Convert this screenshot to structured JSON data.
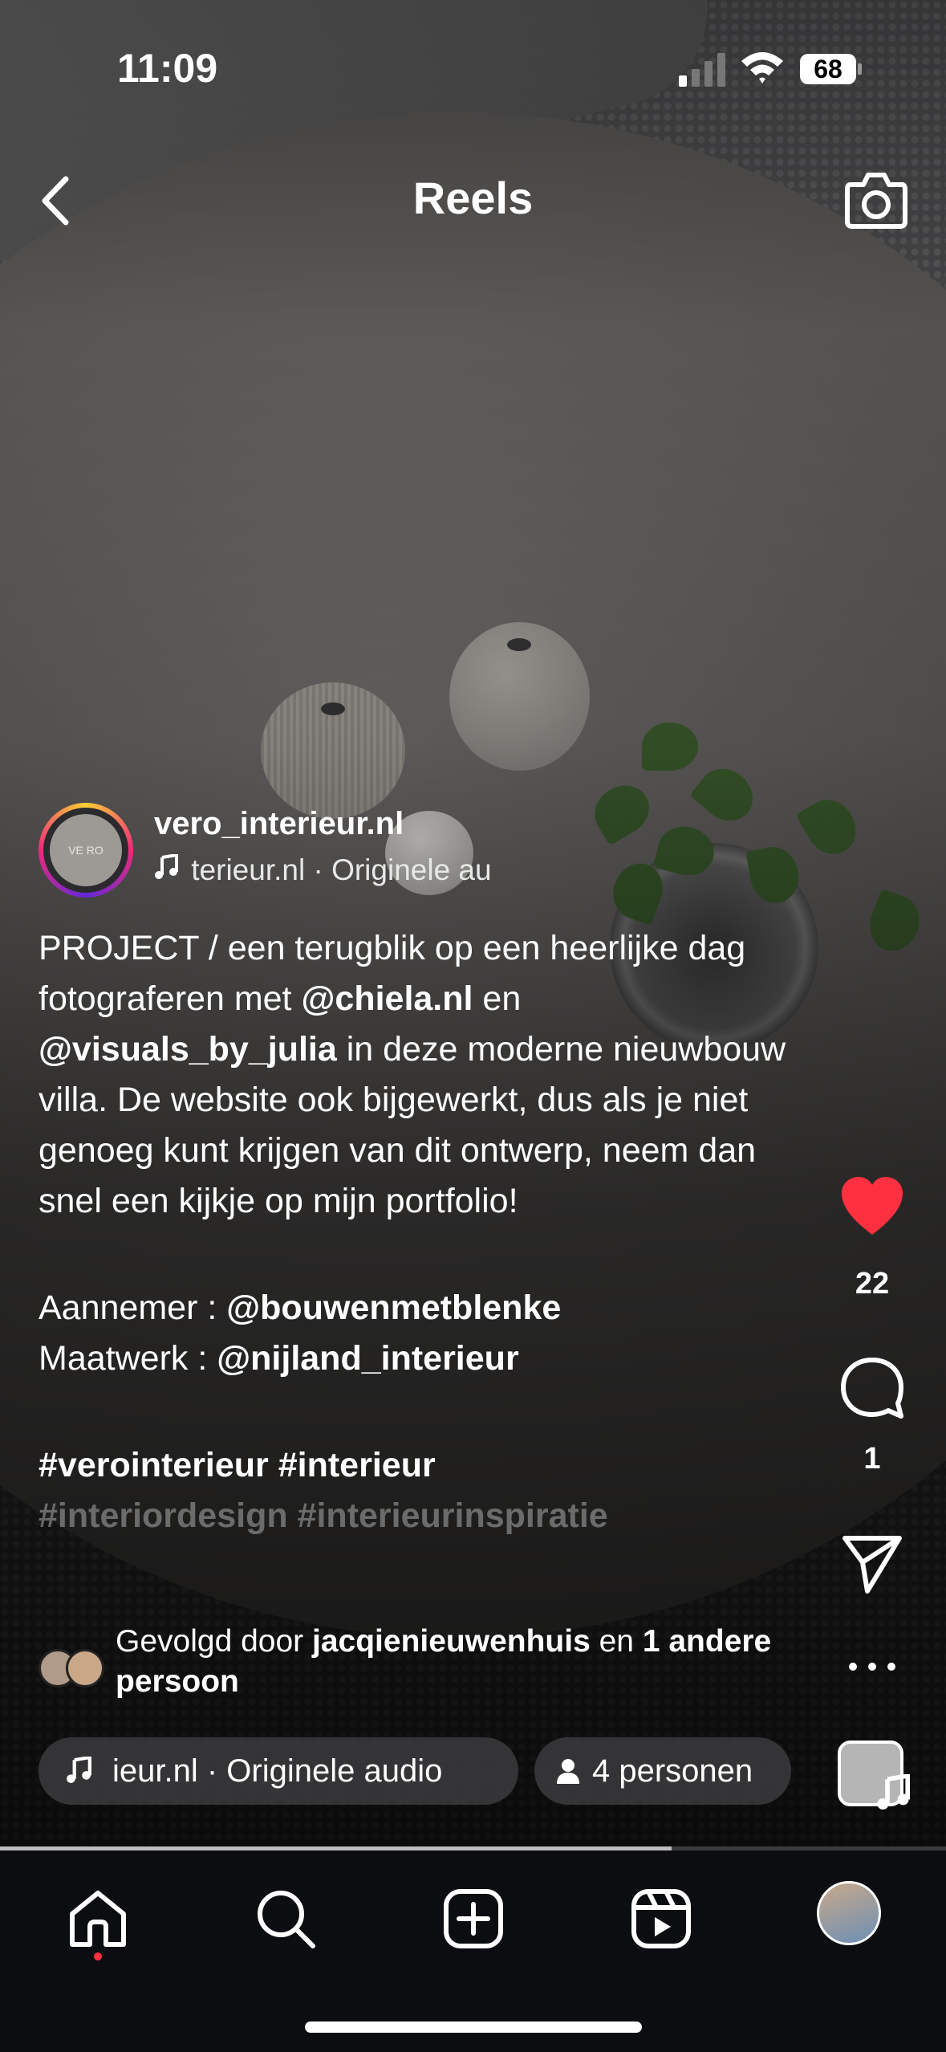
{
  "status": {
    "time": "11:09",
    "battery": "68"
  },
  "header": {
    "title": "Reels"
  },
  "post": {
    "username": "vero_interieur.nl",
    "avatar_text": "VE RO",
    "audio_line": "terieur.nl · Originele au",
    "caption": [
      [
        {
          "t": "PROJECT / een terugblik op een heerlijke dag fotograferen met "
        },
        {
          "t": "@chiela.nl",
          "b": true
        },
        {
          "t": " en "
        },
        {
          "t": "@visuals_by_julia",
          "b": true
        },
        {
          "t": " in deze moderne nieuwbouw villa. De website ook bijgewerkt, dus als je niet genoeg kunt krijgen van dit ontwerp, neem dan snel een kijkje op mijn portfolio!"
        }
      ],
      [
        {
          "t": "Aannemer : "
        },
        {
          "t": "@bouwenmetblenke",
          "b": true
        }
      ],
      [
        {
          "t": "Maatwerk : "
        },
        {
          "t": "@nijland_interieur",
          "b": true
        }
      ],
      [
        {
          "t": "#verointerieur #interieur",
          "b": true
        }
      ],
      [
        {
          "t": "#interiordesign #interieurinspiratie",
          "b": true,
          "fade": true
        }
      ]
    ],
    "likes": "22",
    "comments": "1",
    "followed_prefix": "Gevolgd door ",
    "followed_user": "jacqienieuwenhuis",
    "followed_mid": " en ",
    "followed_rest": "1 andere persoon",
    "audio_pill": "ieur.nl · Originele audio",
    "people_pill": "4 personen",
    "progress": 0.71
  },
  "icons": {
    "back": "chevron-left-icon",
    "camera": "camera-icon",
    "like": "heart-icon",
    "comment": "comment-icon",
    "share": "send-icon",
    "more": "more-icon",
    "music": "music-note-icon",
    "person": "person-icon"
  },
  "tabs": [
    {
      "name": "home",
      "active": true
    },
    {
      "name": "search"
    },
    {
      "name": "create"
    },
    {
      "name": "reels"
    },
    {
      "name": "profile"
    }
  ],
  "colors": {
    "like": "#ff3040",
    "tab_dot": "#ff3040"
  }
}
